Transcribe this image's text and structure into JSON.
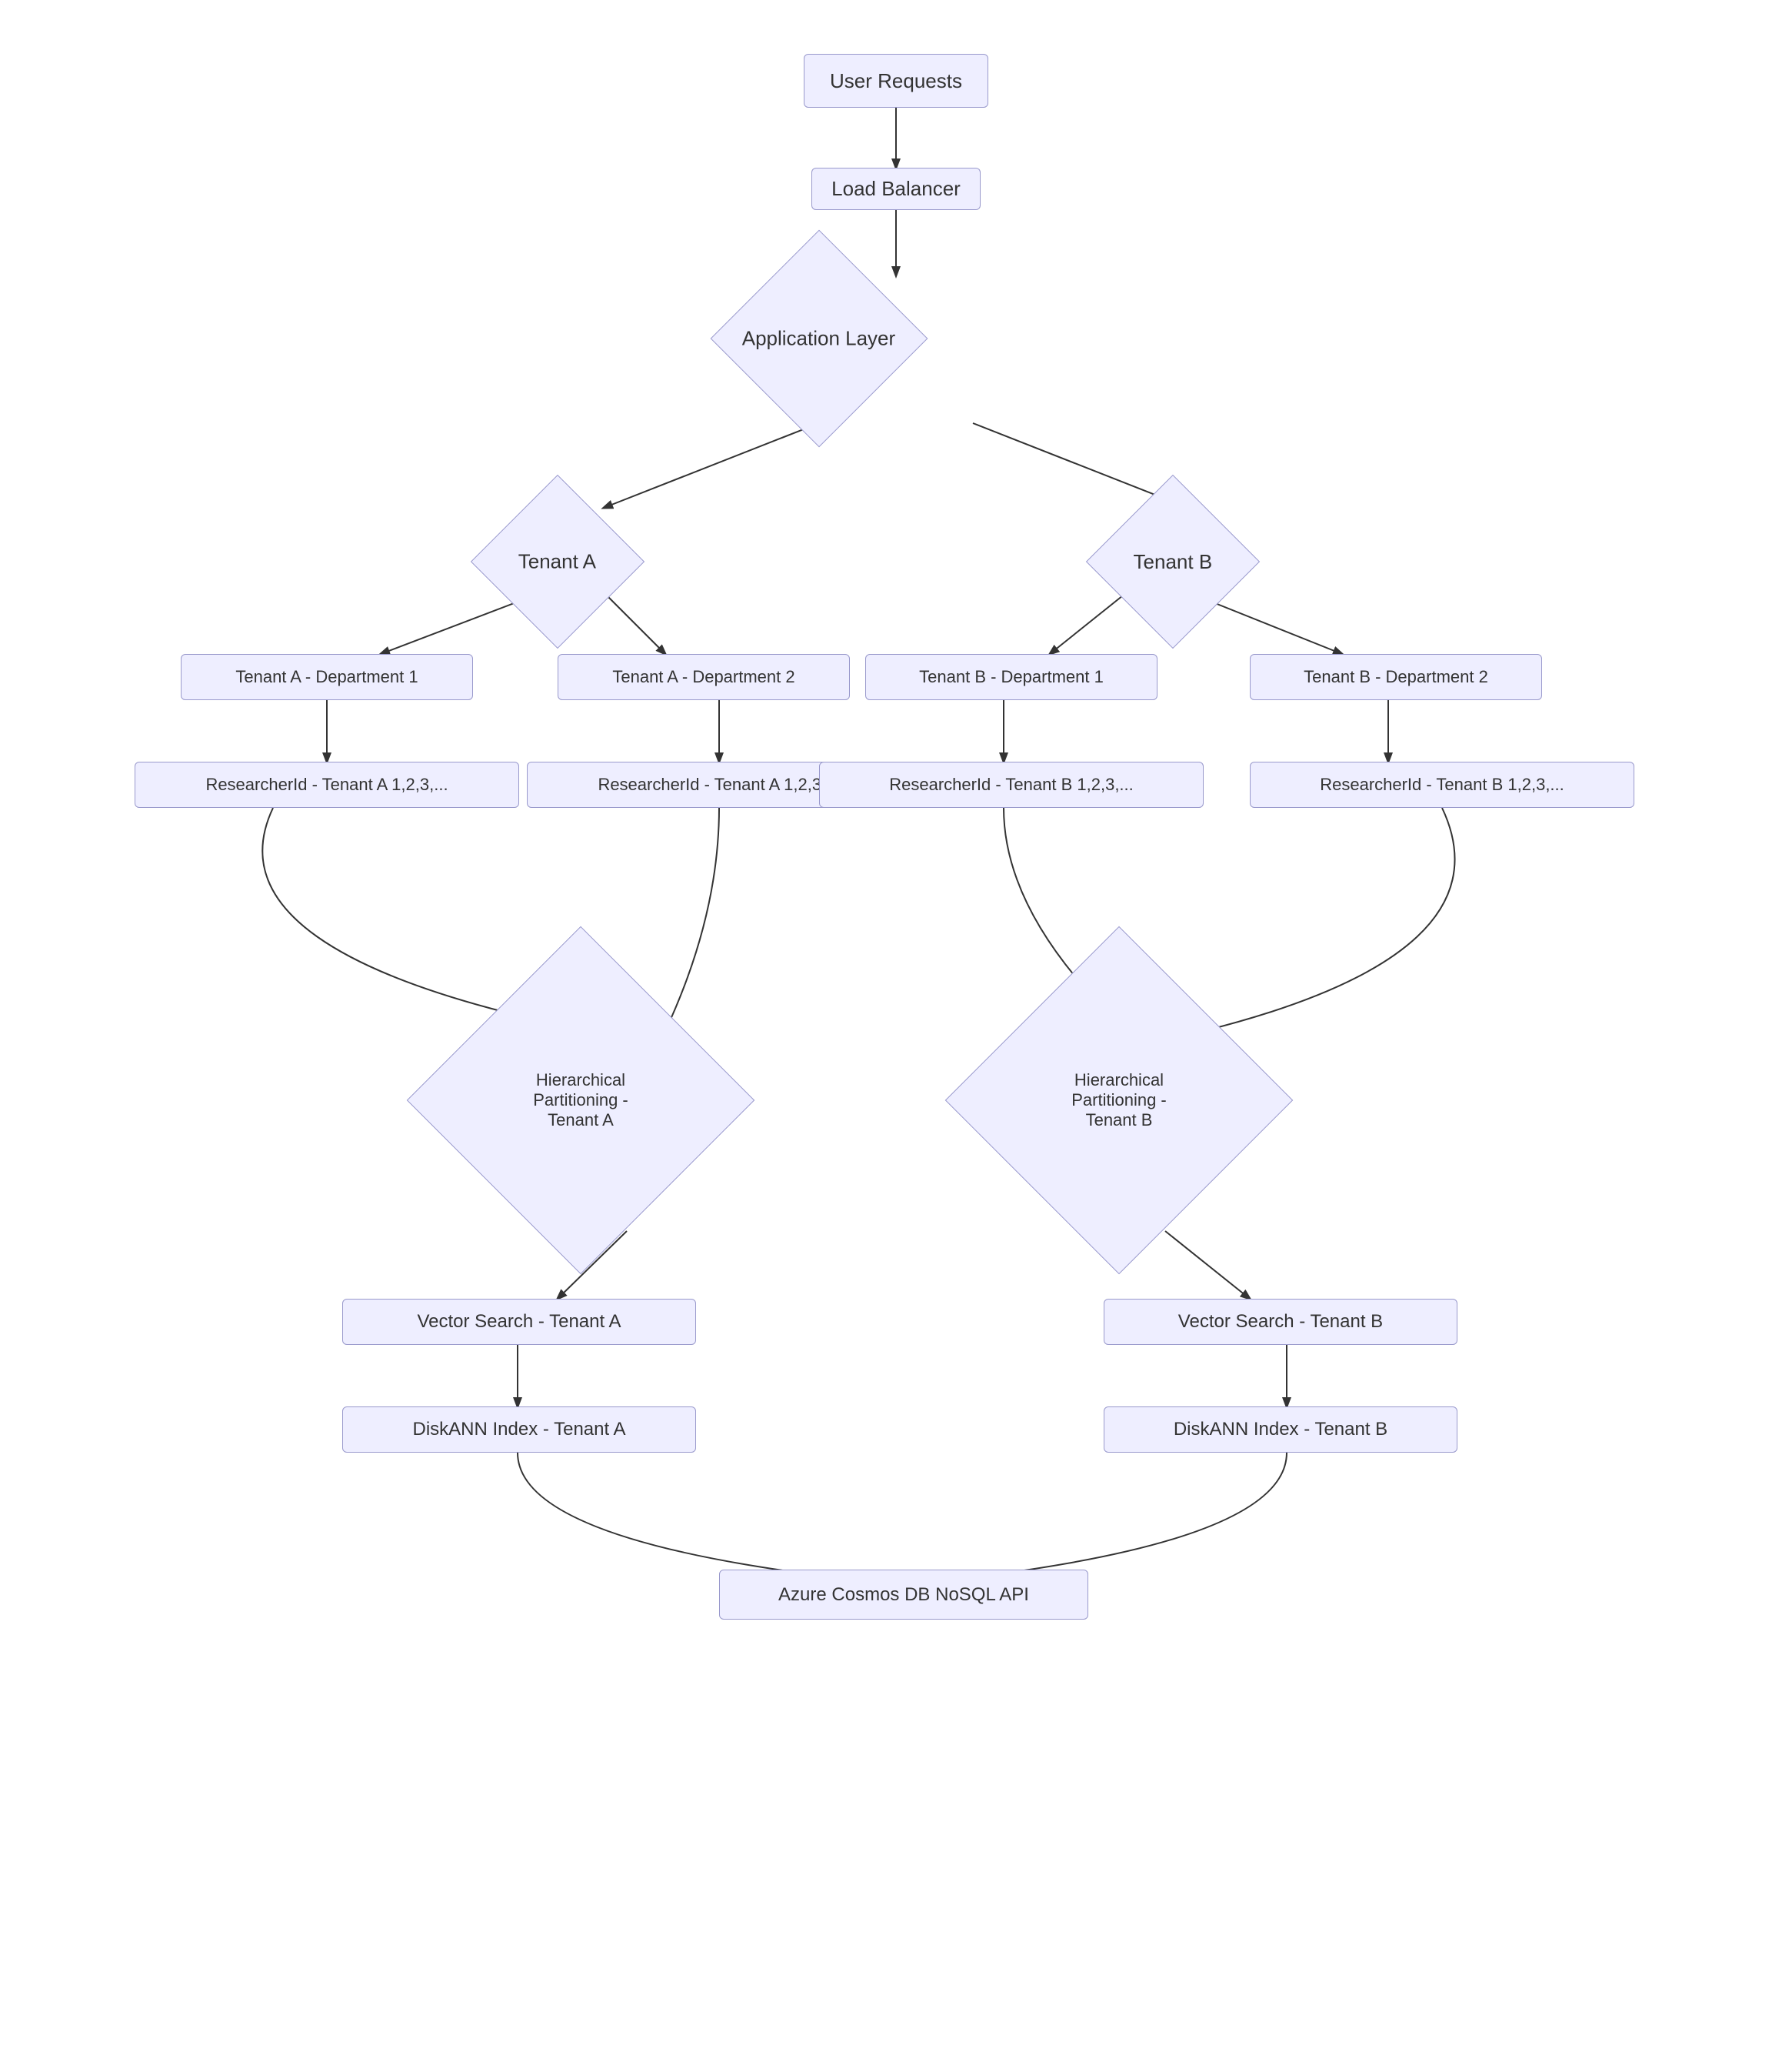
{
  "nodes": {
    "user_requests": {
      "label": "User Requests"
    },
    "load_balancer": {
      "label": "Load Balancer"
    },
    "application_layer": {
      "label": "Application Layer"
    },
    "tenant_a": {
      "label": "Tenant A"
    },
    "tenant_b": {
      "label": "Tenant B"
    },
    "tenant_a_dept1": {
      "label": "Tenant A - Department 1"
    },
    "tenant_a_dept2": {
      "label": "Tenant A - Department 2"
    },
    "tenant_b_dept1": {
      "label": "Tenant B - Department 1"
    },
    "tenant_b_dept2": {
      "label": "Tenant B - Department 2"
    },
    "researcher_a1": {
      "label": "ResearcherId - Tenant A 1,2,3,..."
    },
    "researcher_a2": {
      "label": "ResearcherId - Tenant A 1,2,3,..."
    },
    "researcher_b1": {
      "label": "ResearcherId - Tenant B 1,2,3,..."
    },
    "researcher_b2": {
      "label": "ResearcherId - Tenant B 1,2,3,..."
    },
    "hier_part_a": {
      "label": "Hierarchical Partitioning - Tenant A"
    },
    "hier_part_b": {
      "label": "Hierarchical Partitioning - Tenant B"
    },
    "vector_search_a": {
      "label": "Vector Search - Tenant A"
    },
    "vector_search_b": {
      "label": "Vector Search - Tenant B"
    },
    "diskann_a": {
      "label": "DiskANN Index - Tenant A"
    },
    "diskann_b": {
      "label": "DiskANN Index - Tenant B"
    },
    "azure_cosmos": {
      "label": "Azure Cosmos DB NoSQL API"
    }
  }
}
